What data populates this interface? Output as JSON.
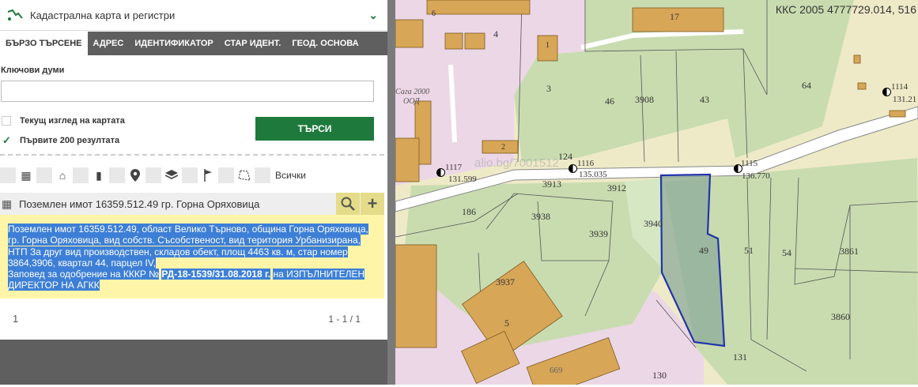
{
  "header": {
    "title": "Кадастрална карта и регистри"
  },
  "tabs": [
    "БЪРЗО ТЪРСЕНЕ",
    "АДРЕС",
    "ИДЕНТИФИКАТОР",
    "СТАР ИДЕНТ.",
    "ГЕОД. ОСНОВА"
  ],
  "search": {
    "keywords_label": "Ключови думи",
    "keywords_value": "",
    "current_view_label": "Текущ изглед на картата",
    "first200_label": "Първите 200 резултата",
    "search_button": "ТЪРСИ",
    "all_label": "Всички"
  },
  "result": {
    "title": "Поземлен имот 16359.512.49 гр. Горна Оряховица",
    "line1": "Поземлен имот 16359.512.49, област Велико Търново, община Горна Оряховица,",
    "line2": "гр. Горна Оряховица, вид собств. Съсобственост, вид територия Урбанизирана,",
    "line3": "НТП За друг вид производствен, складов обект, площ 4463 кв. м, стар номер",
    "line4": "3864,3906, квартал 44, парцел IV,",
    "line5a": "Заповед за одобрение на КККР №",
    "line5b": "РД-18-1539/31.08.2018 г.",
    "line5c": "на ИЗПЪЛНИТЕЛЕН",
    "line6": "ДИРЕКТОР НА АГКК"
  },
  "pager": {
    "page": "1",
    "range": "1 - 1 / 1"
  },
  "map": {
    "coordinates": "ККС 2005 4777729.014, 516",
    "parcel_labels": [
      "3",
      "46",
      "3908",
      "43",
      "64",
      "186",
      "3938",
      "3913",
      "3912",
      "3940",
      "3939",
      "49",
      "51",
      "54",
      "3861",
      "3937",
      "3860",
      "130",
      "131",
      "124",
      "1",
      "2",
      "4",
      "5",
      "6",
      "17"
    ],
    "points": [
      {
        "id": "1117",
        "elev": "131.599"
      },
      {
        "id": "1116",
        "elev": "135.035"
      },
      {
        "id": "1115",
        "elev": "136.770"
      },
      {
        "id": "1114",
        "elev": "131.21"
      }
    ],
    "text_labels": [
      "Сага 2000",
      "ООД",
      "669"
    ],
    "watermark": "alio.bg/7001512"
  }
}
